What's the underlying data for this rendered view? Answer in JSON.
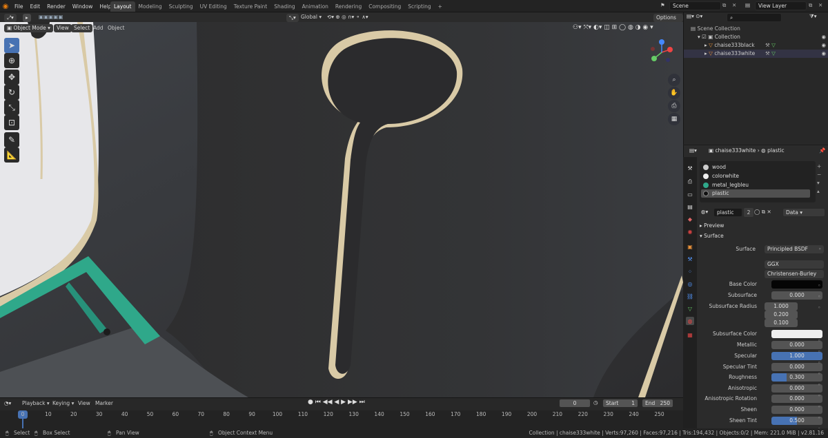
{
  "menu": {
    "items": [
      "File",
      "Edit",
      "Render",
      "Window",
      "Help"
    ]
  },
  "workspaces": [
    {
      "label": "Layout",
      "active": true
    },
    {
      "label": "Modeling"
    },
    {
      "label": "Sculpting"
    },
    {
      "label": "UV Editing"
    },
    {
      "label": "Texture Paint"
    },
    {
      "label": "Shading"
    },
    {
      "label": "Animation"
    },
    {
      "label": "Rendering"
    },
    {
      "label": "Compositing"
    },
    {
      "label": "Scripting"
    }
  ],
  "scene": {
    "name": "Scene",
    "view_layer": "View Layer"
  },
  "viewport_header": {
    "mode": "Object Mode",
    "menus": [
      "View",
      "Select",
      "Add",
      "Object"
    ],
    "transform": "Global",
    "options": "Options"
  },
  "outliner": {
    "root": "Scene Collection",
    "collection": "Collection",
    "objects": [
      "chaise333black",
      "chaise333white"
    ]
  },
  "properties": {
    "object": "chaise333white",
    "material": "plastic",
    "slots": [
      "wood",
      "colorwhite",
      "metal_legbleu",
      "plastic"
    ],
    "material_field": "plastic",
    "users": "2",
    "link": "Data",
    "panels": {
      "preview": "Preview",
      "surface": "Surface"
    },
    "surface_shader": "Principled BSDF",
    "distribution": "GGX",
    "subsurface_method": "Christensen-Burley",
    "rows": [
      {
        "label": "Base Color",
        "value": ""
      },
      {
        "label": "Subsurface",
        "value": "0.000"
      },
      {
        "label": "Subsurface Radius",
        "value": "1.000"
      },
      {
        "label": "",
        "value": "0.200"
      },
      {
        "label": "",
        "value": "0.100"
      },
      {
        "label": "Subsurface Color",
        "value": ""
      },
      {
        "label": "Metallic",
        "value": "0.000"
      },
      {
        "label": "Specular",
        "value": "1.000"
      },
      {
        "label": "Specular Tint",
        "value": "0.000"
      },
      {
        "label": "Roughness",
        "value": "0.300"
      },
      {
        "label": "Anisotropic",
        "value": "0.000"
      },
      {
        "label": "Anisotropic Rotation",
        "value": "0.000"
      },
      {
        "label": "Sheen",
        "value": "0.000"
      },
      {
        "label": "Sheen Tint",
        "value": "0.500"
      }
    ],
    "surface_label": "Surface"
  },
  "timeline": {
    "menus": [
      "Playback",
      "Keying",
      "View",
      "Marker"
    ],
    "current_frame": "0",
    "start_label": "Start",
    "start": "1",
    "end_label": "End",
    "end": "250",
    "ticks": [
      "0",
      "10",
      "20",
      "30",
      "40",
      "50",
      "60",
      "70",
      "80",
      "90",
      "100",
      "110",
      "120",
      "130",
      "140",
      "150",
      "160",
      "170",
      "180",
      "190",
      "200",
      "210",
      "220",
      "230",
      "240",
      "250"
    ]
  },
  "statusbar": {
    "select": "Select",
    "box_select": "Box Select",
    "pan_view": "Pan View",
    "context_menu": "Object Context Menu",
    "stats": "Collection | chaise333white | Verts:97,260 | Faces:97,216 | Tris:194,432 | Objects:0/2 | Mem: 221.0 MiB | v2.81.16"
  },
  "colors": {
    "accent": "#4772b3",
    "active_tab": "#e87d0d",
    "teal": "#2fa88a",
    "wood": "#d8c9a6"
  }
}
